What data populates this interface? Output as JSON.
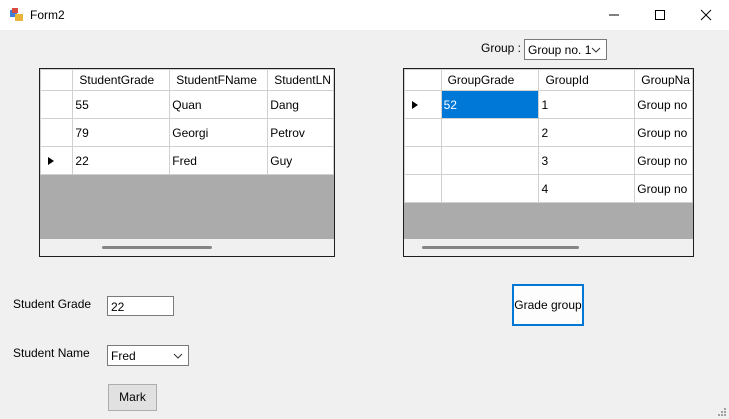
{
  "window": {
    "title": "Form2"
  },
  "group_selector": {
    "label": "Group :",
    "value": "Group no. 1"
  },
  "students_grid": {
    "columns": [
      "StudentGrade",
      "StudentFName",
      "StudentLN"
    ],
    "rows": [
      [
        "55",
        "Quan",
        "Dang"
      ],
      [
        "79",
        "Georgi",
        "Petrov"
      ],
      [
        "22",
        "Fred",
        "Guy"
      ]
    ]
  },
  "groups_grid": {
    "columns": [
      "GroupGrade",
      "GroupId",
      "GroupNa"
    ],
    "rows": [
      [
        "52",
        "1",
        "Group no"
      ],
      [
        "",
        "2",
        "Group no"
      ],
      [
        "",
        "3",
        "Group no"
      ],
      [
        "",
        "4",
        "Group no"
      ]
    ]
  },
  "student_grade": {
    "label": "Student Grade",
    "value": "22"
  },
  "student_name": {
    "label": "Student Name",
    "value": "Fred"
  },
  "buttons": {
    "grade_group": "Grade group",
    "mark": "Mark"
  }
}
